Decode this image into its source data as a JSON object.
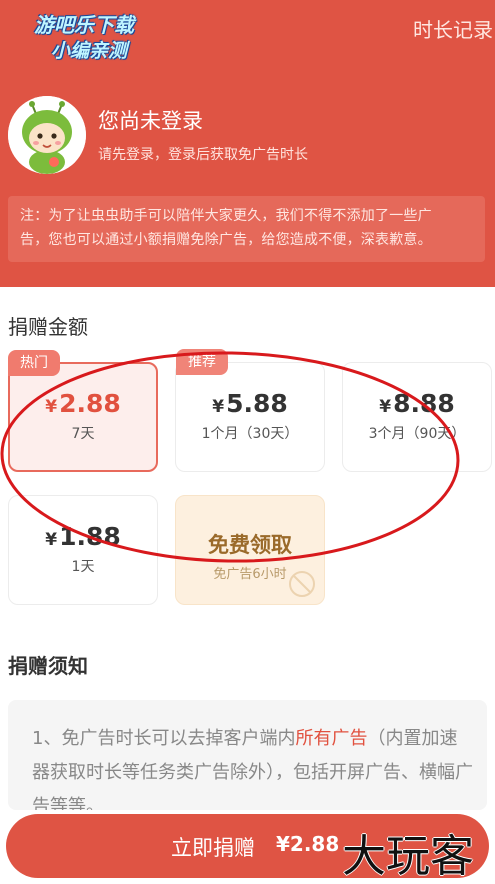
{
  "header": {
    "watermark_line1": "游吧乐下载",
    "watermark_line2": "小编亲测",
    "history_link": "时长记录"
  },
  "user": {
    "login_title": "您尚未登录",
    "login_subtitle": "请先登录，登录后获取免广告时长"
  },
  "notice": {
    "line1": "注：为了让虫虫助手可以陪伴大家更久，我们不得不添加了一些广",
    "line2": "告，您也可以通过小额捐赠免除广告，给您造成不便，深表歉意。"
  },
  "donation": {
    "section_title": "捐赠金额",
    "options": [
      {
        "tag": "热门",
        "yen": "¥",
        "price": "2.88",
        "duration": "7天",
        "selected": true
      },
      {
        "tag": "推荐",
        "yen": "¥",
        "price": "5.88",
        "duration": "1个月（30天）",
        "selected": false
      },
      {
        "tag": "",
        "yen": "¥",
        "price": "8.88",
        "duration": "3个月（90天）",
        "selected": false
      },
      {
        "tag": "",
        "yen": "¥",
        "price": "1.88",
        "duration": "1天",
        "selected": false
      }
    ],
    "free_option": {
      "title": "免费领取",
      "subtitle": "免广告6小时"
    }
  },
  "rules": {
    "section_title": "捐赠须知",
    "text_before": "1、免广告时长可以去掉客户端内",
    "text_highlight": "所有广告",
    "text_after": "（内置加速器获取时长等任务类广告除外），包括开屏广告、横幅广告等等。"
  },
  "footer": {
    "button_label": "立即捐赠",
    "button_amount": "¥2.88",
    "brand_watermark": "大玩客"
  },
  "colors": {
    "primary": "#df5444",
    "selected_price": "#e1513f",
    "free_card_bg": "#fdf0df"
  }
}
